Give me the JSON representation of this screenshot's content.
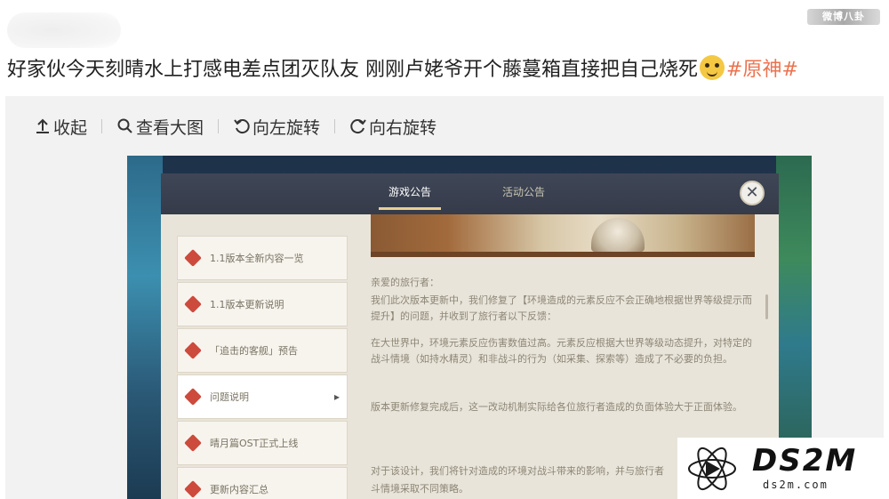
{
  "top_watermark": "微博八卦",
  "post": {
    "text": "好家伙今天刻晴水上打感电差点团灭队友 刚刚卢姥爷开个藤蔓箱直接把自己烧死",
    "hashtag_open": "#",
    "hashtag_label": "原神",
    "hashtag_close": "#",
    "hashtag_color": "#eb7350"
  },
  "toolbar": {
    "items": [
      {
        "label": "收起",
        "icon": "arrow-up-icon"
      },
      {
        "label": "查看大图",
        "icon": "magnifier-icon"
      },
      {
        "label": "向左旋转",
        "icon": "rotate-left-icon"
      },
      {
        "label": "向右旋转",
        "icon": "rotate-right-icon"
      }
    ]
  },
  "notice": {
    "tabs": [
      {
        "label": "游戏公告",
        "active": true
      },
      {
        "label": "活动公告",
        "active": false
      }
    ],
    "sidebar": [
      {
        "label": "1.1版本全新内容一览"
      },
      {
        "label": "1.1版本更新说明"
      },
      {
        "label": "「追击的客舰」预告"
      },
      {
        "label": "问题说明"
      },
      {
        "label": "晴月篇OST正式上线"
      },
      {
        "label": "更新内容汇总"
      }
    ],
    "body": [
      "亲爱的旅行者：",
      "我们此次版本更新中，我们修复了【环境造成的元素反应不会正确地根据世界等级提示而提升】的问题，并收到了旅行者以下反馈：",
      "在大世界中，环境元素反应伤害数值过高。元素反应根据大世界等级动态提升，对特定的战斗情境（如持水精灵）和非战斗的行为（如采集、探索等）造成了不必要的负担。",
      "版本更新修复完成后，这一改动机制实际给各位旅行者造成的负面体验大于正面体验。",
      "对于该设计，我们将针对造成的环境对战斗带来的影响，并与旅行者",
      "斗情境采取不同策略。"
    ]
  },
  "logo": {
    "name": "DS2M",
    "domain": "ds2m.com"
  }
}
